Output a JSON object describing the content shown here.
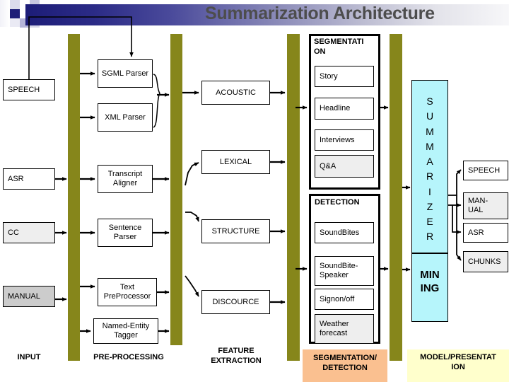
{
  "title": "Summarization Architecture",
  "input_stage": {
    "label": "INPUT",
    "boxes": [
      {
        "label": "SPEECH",
        "fill": "white"
      },
      {
        "label": "ASR",
        "fill": "white"
      },
      {
        "label": "CC",
        "fill": "light-gray"
      },
      {
        "label": "MANUAL",
        "fill": "gray"
      }
    ]
  },
  "preprocessing_stage": {
    "label": "PRE-PROCESSING",
    "boxes": [
      {
        "label": "SGML Parser"
      },
      {
        "label": "XML Parser"
      },
      {
        "label": "Transcript Aligner"
      },
      {
        "label": "Sentence Parser"
      },
      {
        "label": "Text PreProcessor"
      },
      {
        "label": "Named-Entity Tagger"
      }
    ]
  },
  "feature_extraction_stage": {
    "label": "FEATURE EXTRACTION",
    "boxes": [
      {
        "label": "ACOUSTIC"
      },
      {
        "label": "LEXICAL"
      },
      {
        "label": "STRUCTURE"
      },
      {
        "label": "DISCOURCE"
      }
    ]
  },
  "segmentation_detection_stage": {
    "label": "SEGMENTATION/ DETECTION",
    "segmentation_panel": {
      "title": "SEGMENTATION",
      "title_line2": "ON",
      "title_line1": "SEGMENTATI",
      "items": [
        {
          "label": "Story",
          "fill": "white"
        },
        {
          "label": "Headline",
          "fill": "white"
        },
        {
          "label": "Interviews",
          "fill": "white"
        },
        {
          "label": "Q&A",
          "fill": "light-gray"
        }
      ]
    },
    "detection_panel": {
      "title": "DETECTION",
      "items": [
        {
          "label": "SoundBites",
          "fill": "white"
        },
        {
          "label": "SoundBite-Speaker",
          "fill": "white"
        },
        {
          "label": "Signon/off",
          "fill": "white"
        },
        {
          "label": "Weather forecast",
          "fill": "light-gray"
        }
      ]
    }
  },
  "model_presentation_stage": {
    "label": "MODEL/PRESENTATION",
    "label_line1": "MODEL/PRESENTAT",
    "label_line2": "ION",
    "summarizer": {
      "letters": [
        "S",
        "U",
        "M",
        "M",
        "A",
        "R",
        "I",
        "Z",
        "E",
        "R"
      ],
      "word": "SUMMARIZER"
    },
    "mining": {
      "line1": "MIN",
      "line2": "ING",
      "word": "MINING"
    },
    "outputs": [
      {
        "label": "SPEECH",
        "fill": "white"
      },
      {
        "label": "MAN-UAL",
        "line1": "MAN-",
        "line2": "UAL",
        "fill": "light-gray"
      },
      {
        "label": "ASR",
        "fill": "white"
      },
      {
        "label": "CHUNKS",
        "fill": "light-gray"
      }
    ]
  },
  "colors": {
    "olive_column": "#86861b",
    "cyan_panel": "#b6f5fb",
    "peach_label": "#fac090",
    "cream_label": "#ffffcc",
    "title_text": "#4d4d4d",
    "title_band_start": "#1d1d78"
  }
}
